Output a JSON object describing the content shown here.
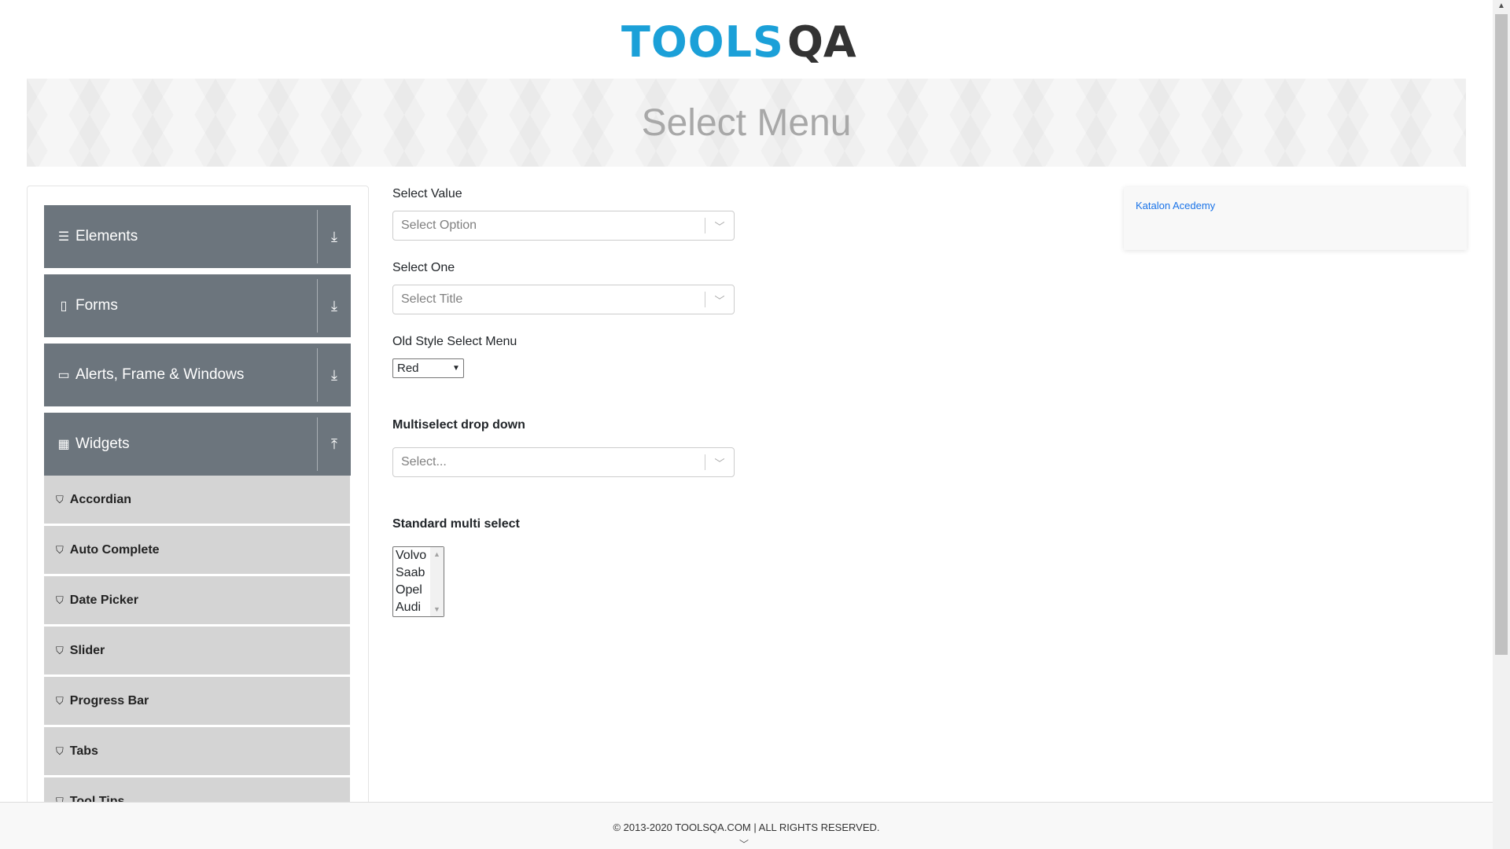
{
  "logo": {
    "text_blue": "TOOLS",
    "text_dark": "QA"
  },
  "banner": {
    "title": "Select Menu"
  },
  "sidebar": {
    "groups": [
      {
        "label": "Elements",
        "icon": "hamburger-icon",
        "arrow": "download-arrow-icon"
      },
      {
        "label": "Forms",
        "icon": "document-icon",
        "arrow": "download-arrow-icon"
      },
      {
        "label": "Alerts, Frame & Windows",
        "icon": "window-icon",
        "arrow": "download-arrow-icon"
      },
      {
        "label": "Widgets",
        "icon": "grid-icon",
        "arrow": "upload-arrow-icon"
      }
    ],
    "items": [
      {
        "label": "Accordian"
      },
      {
        "label": "Auto Complete"
      },
      {
        "label": "Date Picker"
      },
      {
        "label": "Slider"
      },
      {
        "label": "Progress Bar"
      },
      {
        "label": "Tabs"
      },
      {
        "label": "Tool Tips"
      }
    ]
  },
  "form": {
    "select_value": {
      "label": "Select Value",
      "placeholder": "Select Option"
    },
    "select_one": {
      "label": "Select One",
      "placeholder": "Select Title"
    },
    "old_style": {
      "label": "Old Style Select Menu",
      "selected": "Red"
    },
    "multiselect": {
      "label": "Multiselect drop down",
      "placeholder": "Select..."
    },
    "standard_multi": {
      "label": "Standard multi select",
      "options": [
        "Volvo",
        "Saab",
        "Opel",
        "Audi"
      ]
    }
  },
  "ad": {
    "alt": "Katalon Acedemy"
  },
  "footer": {
    "copyright": "© 2013-2020 TOOLSQA.COM | ALL RIGHTS RESERVED."
  },
  "colors": {
    "brand_blue": "#1ba0d8",
    "sidebar_group": "#6c757d",
    "sidebar_item": "#d4d4d4"
  }
}
